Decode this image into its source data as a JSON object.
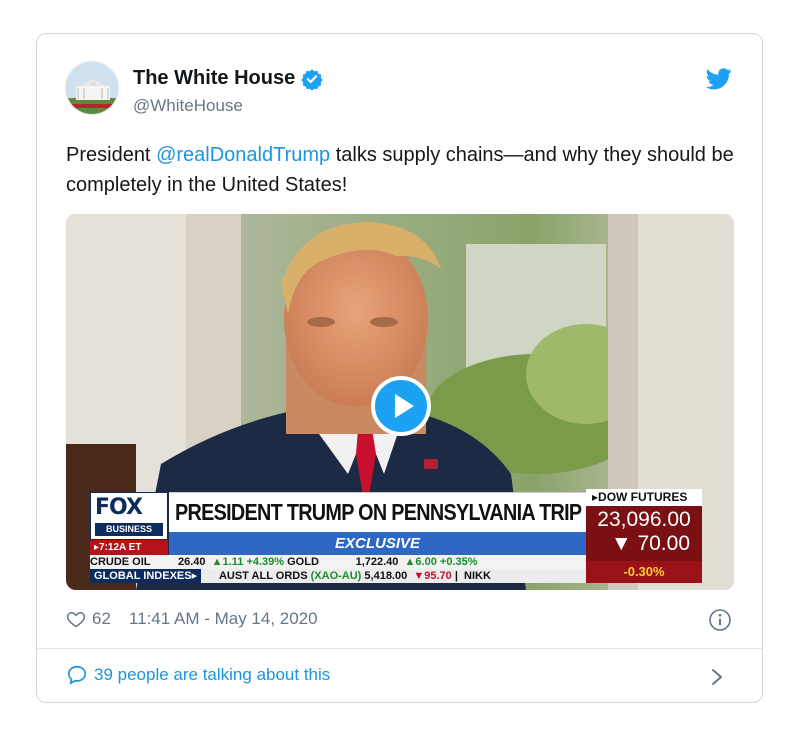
{
  "user": {
    "display_name": "The White House",
    "handle": "@WhiteHouse"
  },
  "tweet": {
    "text_before": "President ",
    "mention": "@realDonaldTrump",
    "text_after": " talks supply chains—and why they should be completely in the United States!"
  },
  "video": {
    "network_logo": "FOX",
    "network_sub": "BUSINESS",
    "time_badge": "▸7:12A ET",
    "headline": "PRESIDENT TRUMP ON PENNSYLVANIA TRIP",
    "exclusive": "EXCLUSIVE",
    "ticker_line1": {
      "crude_label": "CRUDE OIL",
      "crude_value": "26.40",
      "crude_change": "▲1.11",
      "crude_pct": "+4.39%",
      "gold_label": "GOLD",
      "gold_value": "1,722.40",
      "gold_change": "▲6.00",
      "gold_pct": "+0.35%"
    },
    "ticker_line2": {
      "label": "GLOBAL INDEXES▸",
      "index_name": "AUST ALL ORDS",
      "index_code": "(XAO-AU)",
      "index_value": "5,418.00",
      "index_change": "▼95.70",
      "next": "NIKK"
    },
    "dow": {
      "head": "▸DOW FUTURES",
      "value": "23,096.00",
      "change": "▼ 70.00",
      "pct": "-0.30%"
    }
  },
  "meta": {
    "likes": "62",
    "timestamp": "11:41 AM - May 14, 2020"
  },
  "footer": {
    "talking": "39 people are talking about this"
  },
  "colors": {
    "link": "#1b95e0",
    "secondary_text": "#657786",
    "border": "#cfd9de",
    "fox_red": "#7a0f14",
    "fox_blue": "#2e67c4"
  },
  "icons": [
    "avatar",
    "verified-badge-icon",
    "twitter-bird-icon",
    "play-icon",
    "heart-icon",
    "info-icon",
    "speech-bubble-icon",
    "chevron-right-icon"
  ]
}
